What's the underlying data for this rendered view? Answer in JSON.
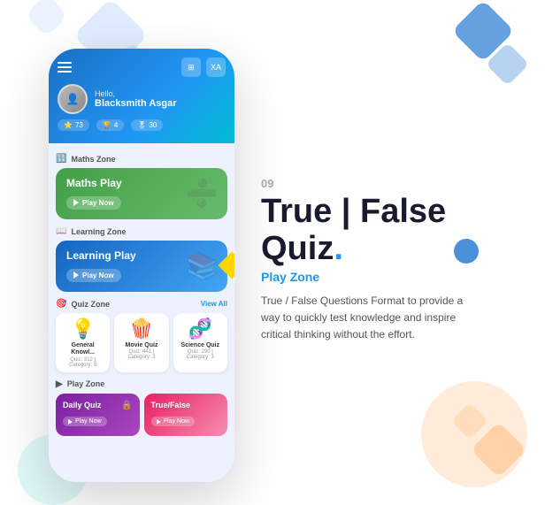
{
  "background": {
    "shapes": [
      "diamond-1",
      "diamond-2",
      "circle-1",
      "blob-orange",
      "blob-teal"
    ]
  },
  "phone": {
    "header": {
      "greeting": "Hello,",
      "username": "Blacksmith Asgar",
      "stats": [
        {
          "icon": "⭐",
          "value": "73"
        },
        {
          "icon": "🏆",
          "value": "4"
        },
        {
          "icon": "🎖",
          "value": "30"
        }
      ]
    },
    "sections": [
      {
        "name": "Maths Zone",
        "icon": "🔢",
        "card": {
          "title": "Maths Play",
          "type": "maths",
          "play_label": "Play Now"
        }
      },
      {
        "name": "Learning Zone",
        "icon": "📖",
        "card": {
          "title": "Learning Play",
          "type": "learning",
          "play_label": "Play Now"
        }
      },
      {
        "name": "Quiz Zone",
        "icon": "🎯",
        "view_all": "View All",
        "quiz_cards": [
          {
            "name": "General Knowl...",
            "meta": "Quiz: 312 | Category: 5",
            "emoji": "💡"
          },
          {
            "name": "Movie Quiz",
            "meta": "Quiz: 441 | Category: 3",
            "emoji": "🍿"
          },
          {
            "name": "Science Quiz",
            "meta": "Quiz: 290 | Category: 3",
            "emoji": "🧬"
          }
        ]
      },
      {
        "name": "Play Zone",
        "icon": "▶",
        "play_cards": [
          {
            "title": "Daily Quiz",
            "type": "purple",
            "play_label": "Play Now",
            "has_lock": true
          },
          {
            "title": "True/False",
            "type": "pink",
            "play_label": "Play Now",
            "has_lock": false
          }
        ]
      }
    ]
  },
  "right_panel": {
    "step": "09",
    "title_line1": "True | False",
    "title_line2": "Quiz",
    "title_dot": ".",
    "subtitle": "Play Zone",
    "description": "True / False Questions Format to provide a way to quickly test knowledge and inspire critical thinking without the effort."
  }
}
